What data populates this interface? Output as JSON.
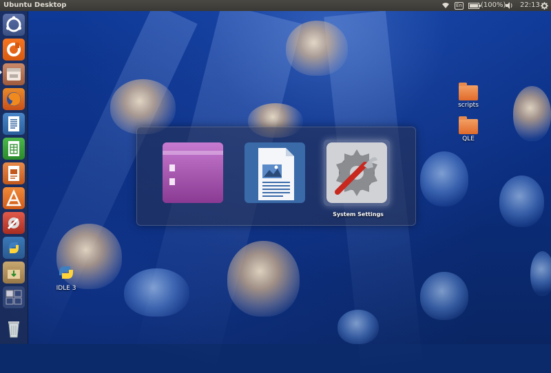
{
  "panel": {
    "title": "Ubuntu Desktop",
    "keyboard_layout": "En",
    "battery_text": "(100%)",
    "battery_level": 1.0,
    "clock": "22:13",
    "icons": [
      "wifi-icon",
      "keyboard-icon",
      "battery-icon",
      "volume-icon",
      "gear-icon"
    ]
  },
  "launcher": {
    "items": [
      {
        "name": "dash-home",
        "icon": "ubuntu-logo-icon"
      },
      {
        "name": "ubuntu-one",
        "icon": "ubuntu-one-icon"
      },
      {
        "name": "file-manager",
        "icon": "files-icon"
      },
      {
        "name": "firefox",
        "icon": "firefox-icon"
      },
      {
        "name": "libreoffice-writer",
        "icon": "writer-icon"
      },
      {
        "name": "libreoffice-calc",
        "icon": "calc-icon"
      },
      {
        "name": "libreoffice-impress",
        "icon": "impress-icon"
      },
      {
        "name": "software-center",
        "icon": "software-center-icon"
      },
      {
        "name": "system-settings",
        "icon": "settings-icon"
      },
      {
        "name": "idle",
        "icon": "python-icon"
      },
      {
        "name": "archive-manager",
        "icon": "archive-icon"
      },
      {
        "name": "workspace-switcher",
        "icon": "workspace-icon"
      },
      {
        "name": "trash",
        "icon": "trash-icon"
      }
    ]
  },
  "desktop": {
    "icons": [
      {
        "label": "scripts",
        "icon": "folder-icon"
      },
      {
        "label": "QLE",
        "icon": "folder-icon"
      },
      {
        "label": "IDLE 3",
        "icon": "python-icon"
      }
    ]
  },
  "switcher": {
    "items": [
      {
        "icon": "files-window-icon"
      },
      {
        "icon": "writer-document-icon"
      },
      {
        "icon": "system-settings-icon"
      }
    ],
    "selected_label": "System Settings"
  },
  "colors": {
    "panel_bg": "#3a3935",
    "launcher_bg": "#1e2d50",
    "wallpaper": "#0f3a98",
    "folder": "#e06a2a"
  }
}
